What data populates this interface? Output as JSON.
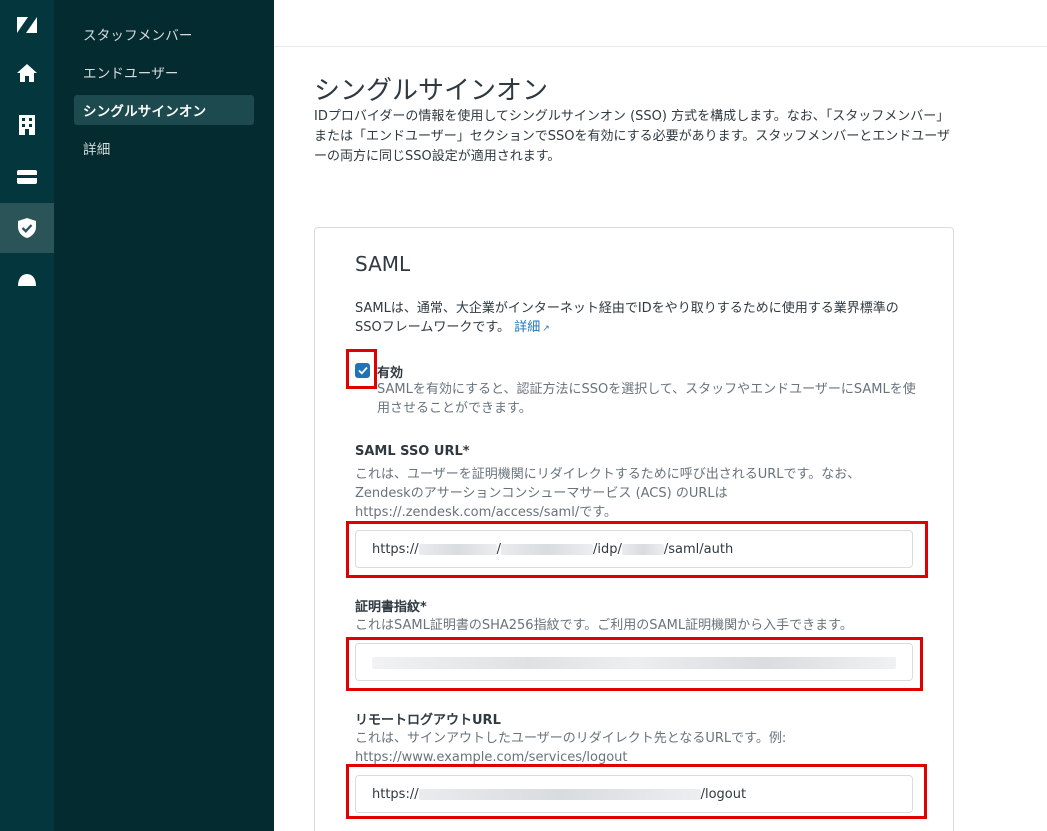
{
  "rail": {
    "items": [
      {
        "icon": "zendesk-logo-icon"
      },
      {
        "icon": "home-icon"
      },
      {
        "icon": "building-icon"
      },
      {
        "icon": "card-icon"
      },
      {
        "icon": "shield-icon"
      },
      {
        "icon": "cloud-icon"
      }
    ],
    "accent": "#03363d"
  },
  "subnav": {
    "items": [
      {
        "label": "スタッフメンバー"
      },
      {
        "label": "エンドユーザー"
      },
      {
        "label": "シングルサインオン",
        "active": true
      },
      {
        "label": "詳細"
      }
    ]
  },
  "page": {
    "title": "シングルサインオン",
    "description": "IDプロバイダーの情報を使用してシングルサインオン (SSO) 方式を構成します。なお、「スタッフメンバー」または「エンドユーザー」セクションでSSOを有効にする必要があります。スタッフメンバーとエンドユーザーの両方に同じSSO設定が適用されます。"
  },
  "saml": {
    "title": "SAML",
    "description": "SAMLは、通常、大企業がインターネット経由でIDをやり取りするために使用する業界標準のSSOフレームワークです。",
    "learn_more": "詳細",
    "enabled": {
      "label": "有効",
      "checked": true,
      "hint": "SAMLを有効にすると、認証方法にSSOを選択して、スタッフやエンドユーザーにSAMLを使用させることができます。"
    },
    "sso_url": {
      "label": "SAML SSO URL*",
      "hint": "これは、ユーザーを証明機関にリダイレクトするために呼び出されるURLです。なお、Zendeskのアサーションコンシューマサービス (ACS) のURLは https://.zendesk.com/access/saml/です。",
      "value_prefix": "https://",
      "value_sep1": "/",
      "value_sep2": "/idp/",
      "value_suffix": "/saml/auth"
    },
    "fingerprint": {
      "label": "証明書指紋*",
      "hint": "これはSAML証明書のSHA256指紋です。ご利用のSAML証明機関から入手できます。"
    },
    "logout_url": {
      "label": "リモートログアウトURL",
      "hint": "これは、サインアウトしたユーザーのリダイレクト先となるURLです。例: https://www.example.com/services/logout",
      "value_prefix": "https://",
      "value_suffix": "/logout"
    }
  },
  "colors": {
    "highlight": "#e00000",
    "link": "#1f73b7",
    "checkbox": "#1f73b7"
  }
}
